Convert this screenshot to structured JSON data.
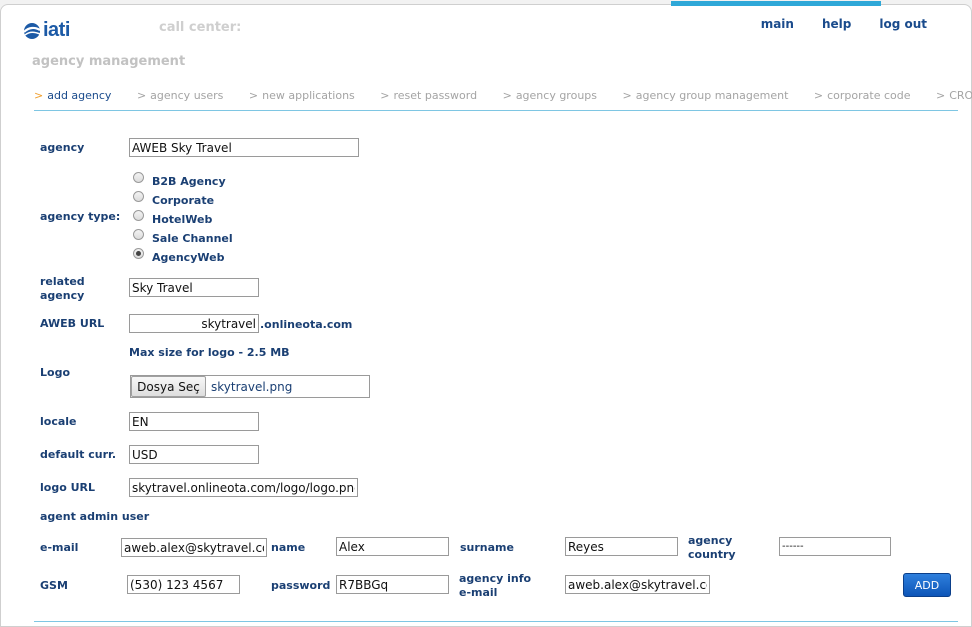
{
  "brand": {
    "logo_text": "iati"
  },
  "header": {
    "callcenter_label": "call center:",
    "page_title": "agency management",
    "nav": [
      "main",
      "help",
      "log out"
    ]
  },
  "subnav": {
    "separator": ">",
    "items": [
      "add agency",
      "agency users",
      "new applications",
      "reset password",
      "agency groups",
      "agency group management",
      "corporate code",
      "CRO panel"
    ],
    "active": "add agency"
  },
  "form": {
    "agency": {
      "label": "agency",
      "value": "AWEB Sky Travel"
    },
    "agency_type": {
      "label": "agency type:",
      "options": [
        "B2B Agency",
        "Corporate",
        "HotelWeb",
        "Sale Channel",
        "AgencyWeb"
      ],
      "selected": "AgencyWeb"
    },
    "related_agency": {
      "label": "related agency",
      "value": "Sky Travel"
    },
    "aweb_url": {
      "label": "AWEB URL",
      "value": "skytravel",
      "suffix": ".onlineota.com"
    },
    "logo": {
      "label": "Logo",
      "note": "Max size for logo - 2.5 MB",
      "button": "Dosya Seç",
      "file": "skytravel.png"
    },
    "locale": {
      "label": "locale",
      "value": "EN"
    },
    "default_curr": {
      "label": "default curr.",
      "value": "USD"
    },
    "logo_url": {
      "label": "logo URL",
      "value": "skytravel.onlineota.com/logo/logo.png"
    },
    "agent_admin_heading": "agent admin user",
    "email": {
      "label": "e-mail",
      "value": "aweb.alex@skytravel.com"
    },
    "name": {
      "label": "name",
      "value": "Alex"
    },
    "surname": {
      "label": "surname",
      "value": "Reyes"
    },
    "agency_country": {
      "label": "agency country",
      "value": "------"
    },
    "gsm": {
      "label": "GSM",
      "value": "(530) 123 4567"
    },
    "password": {
      "label": "password",
      "value": "R7BBGq"
    },
    "agency_info_email": {
      "label": "agency info e-mail",
      "value": "aweb.alex@skytravel.com"
    },
    "add_button": "ADD"
  },
  "colors": {
    "brand_blue": "#1c5aa6",
    "label_navy": "#1a3f73",
    "accent_cyan": "#2fa8d8",
    "active_arrow": "#f0a030"
  }
}
